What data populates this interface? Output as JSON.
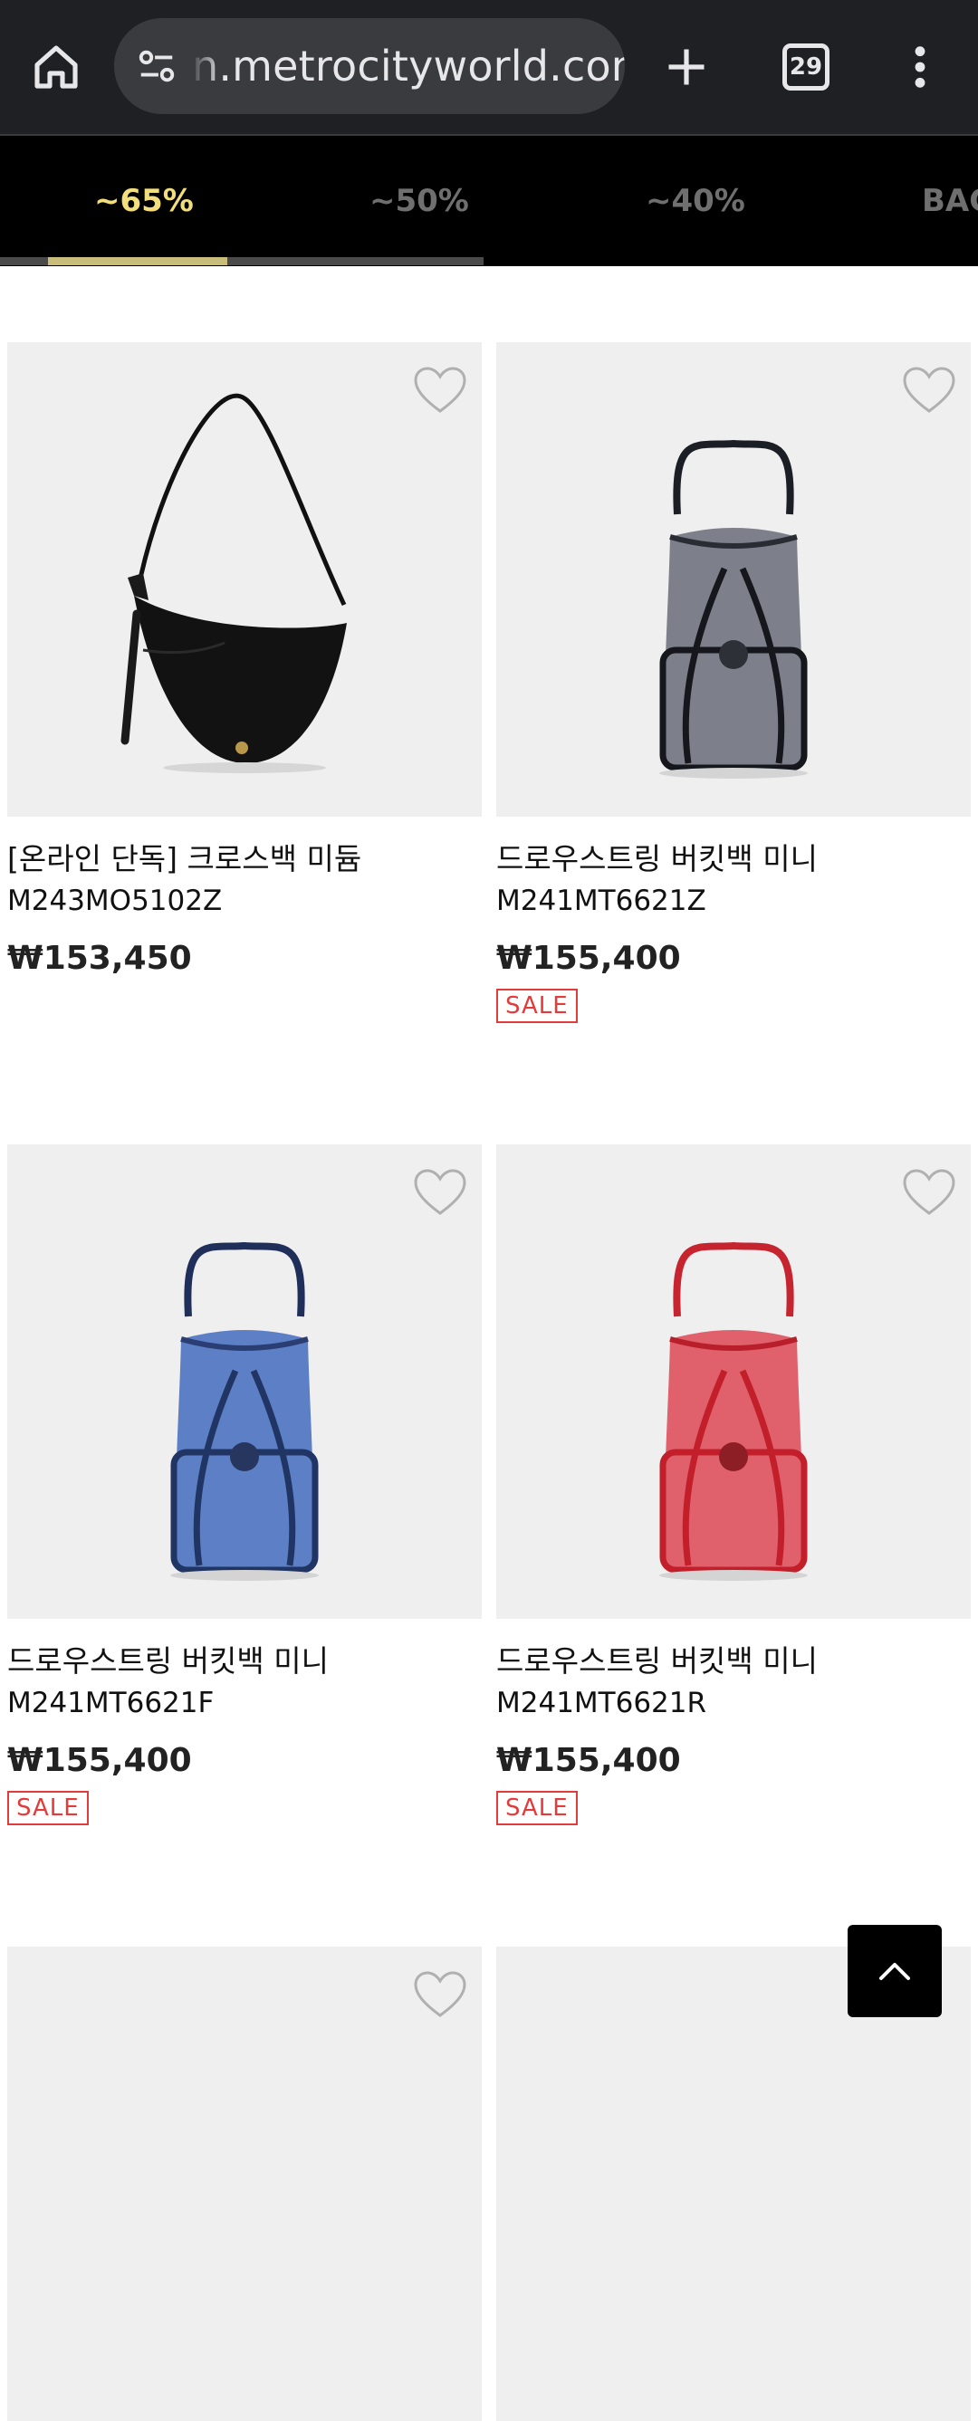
{
  "browser": {
    "url": "n.metrocityworld.com",
    "tab_count": "29",
    "icons": [
      "home-icon",
      "site-info-icon",
      "new-tab-icon",
      "tab-switcher-icon",
      "more-menu-icon"
    ]
  },
  "categories": [
    {
      "label": "~65%",
      "active": true
    },
    {
      "label": "~50%",
      "active": false
    },
    {
      "label": "~40%",
      "active": false
    },
    {
      "label": "BAG",
      "active": false
    }
  ],
  "colors": {
    "active_tab": "#f2de7c",
    "sale": "#e23b3b",
    "navy_bag": "#5d7fc6",
    "red_bag": "#e0606c"
  },
  "products": [
    {
      "name": "[온라인 단독] 크로스백 미듐",
      "code": "M243MO5102Z",
      "price": "₩153,450",
      "sale": ""
    },
    {
      "name": "드로우스트링 버킷백 미니",
      "code": "M241MT6621Z",
      "price": "₩155,400",
      "sale": "SALE"
    },
    {
      "name": "드로우스트링 버킷백 미니",
      "code": "M241MT6621F",
      "price": "₩155,400",
      "sale": "SALE"
    },
    {
      "name": "드로우스트링 버킷백 미니",
      "code": "M241MT6621R",
      "price": "₩155,400",
      "sale": "SALE"
    }
  ]
}
